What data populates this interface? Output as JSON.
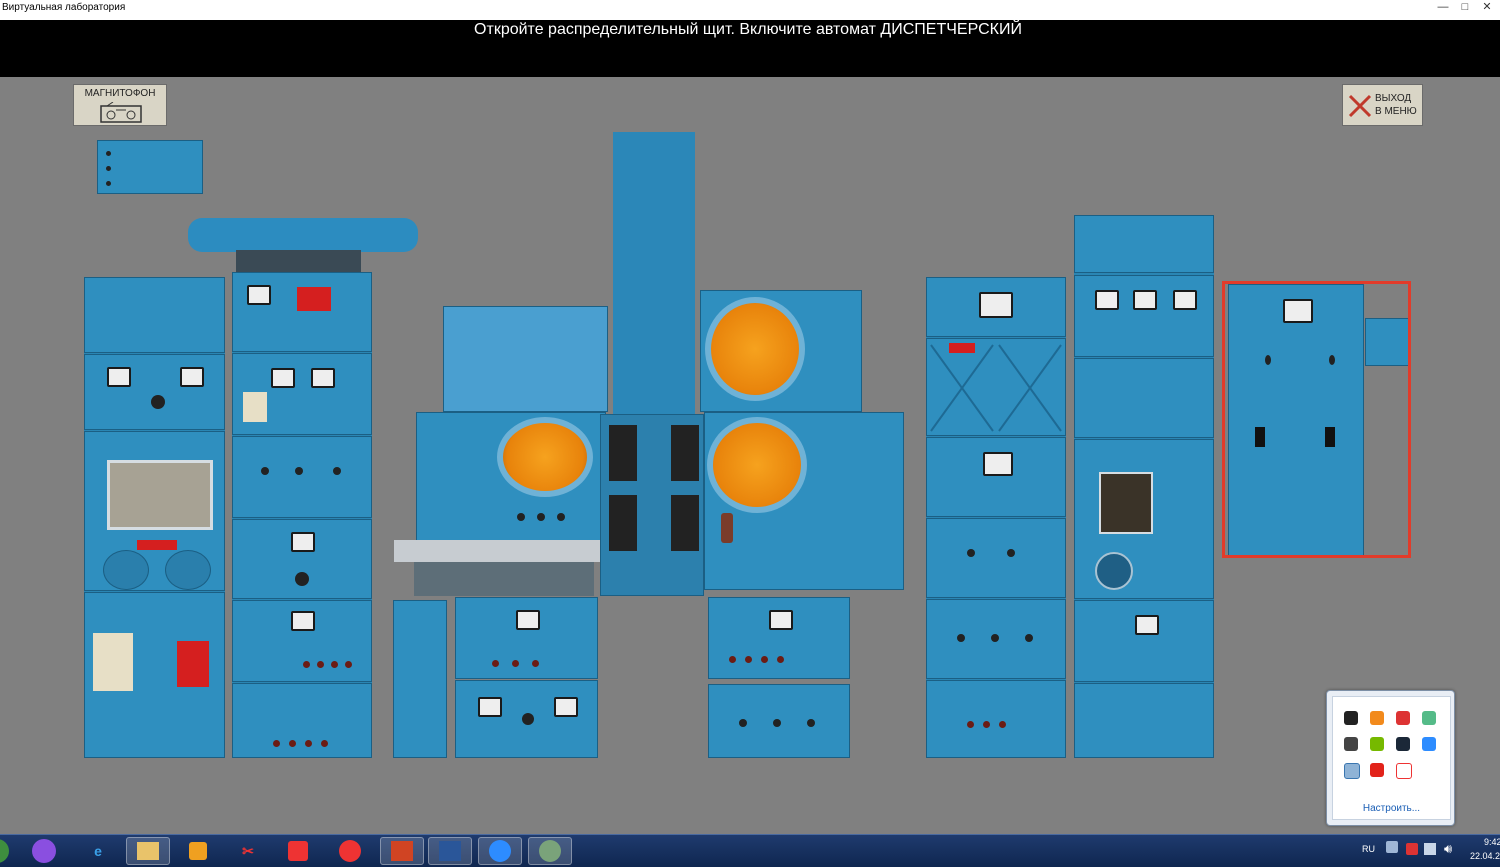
{
  "window": {
    "title": "Виртуальная лаборатория",
    "minimize_glyph": "—",
    "maximize_glyph": "□",
    "close_glyph": "✕"
  },
  "instruction": "Откройте распределительный щит. Включите автомат ДИСПЕТЧЕРСКИЙ",
  "buttons": {
    "magnitofon_label": "МАГНИТОФОН",
    "magnitofon_icon": "tape-recorder-icon",
    "exit_label_line1": "ВЫХОД",
    "exit_label_line2": "В МЕНЮ",
    "exit_icon": "close-x-icon"
  },
  "colors": {
    "equipment_blue": "#2a86b4",
    "selection_outline": "#e23b2a",
    "background": "#808080",
    "scope_orange": "#f0901a"
  },
  "tray_popup": {
    "icons": [
      "terminal-icon",
      "avast-icon",
      "cleaner-icon",
      "usb-icon",
      "tablet-icon",
      "nvidia-icon",
      "steam-icon",
      "zoom-icon",
      "app-icon",
      "acrobat-icon",
      "yandex-icon"
    ],
    "customize_link": "Настроить..."
  },
  "taskbar": {
    "apps": [
      "start-orb",
      "alice-icon",
      "ie-icon",
      "explorer-icon",
      "media-player-icon",
      "snipping-tool-icon",
      "yandex-icon",
      "yandex-browser-icon",
      "powerpoint-icon",
      "word-icon",
      "zoom-icon",
      "lab-app-icon"
    ],
    "language": "RU",
    "time": "9:42",
    "date": "22.04.2"
  }
}
